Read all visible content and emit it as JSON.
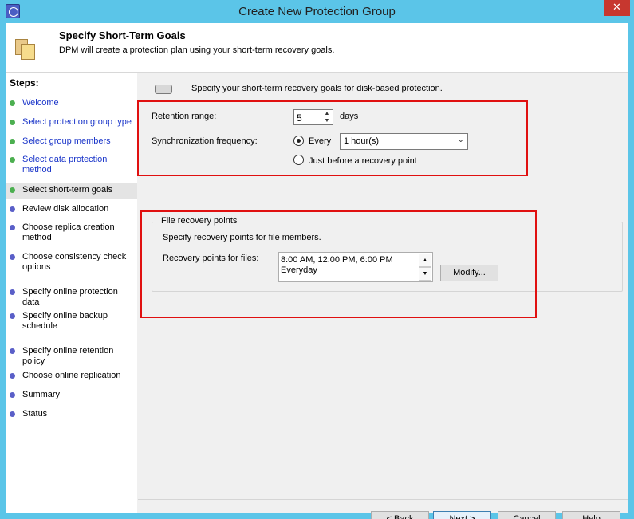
{
  "window": {
    "title": "Create New Protection Group",
    "close_glyph": "✕"
  },
  "header": {
    "title": "Specify Short-Term Goals",
    "description": "DPM will create a protection plan using your short-term recovery goals."
  },
  "steps": {
    "title": "Steps:",
    "items": [
      {
        "label": "Welcome",
        "status": "done"
      },
      {
        "label": "Select protection group type",
        "status": "done"
      },
      {
        "label": "Select group members",
        "status": "done"
      },
      {
        "label": "Select data protection method",
        "status": "done"
      },
      {
        "label": "Select short-term goals",
        "status": "current"
      },
      {
        "label": "Review disk allocation",
        "status": "pending"
      },
      {
        "label": "Choose replica creation method",
        "status": "pending"
      },
      {
        "label": "Choose consistency check options",
        "status": "pending"
      },
      {
        "label": "Specify online protection data",
        "status": "pending"
      },
      {
        "label": "Specify online backup schedule",
        "status": "pending"
      },
      {
        "label": "Specify online retention policy",
        "status": "pending"
      },
      {
        "label": "Choose online replication",
        "status": "pending"
      },
      {
        "label": "Summary",
        "status": "pending"
      },
      {
        "label": "Status",
        "status": "pending"
      }
    ]
  },
  "main": {
    "intro": "Specify your short-term recovery goals for disk-based protection.",
    "retention": {
      "label": "Retention range:",
      "value": "5",
      "unit": "days"
    },
    "sync": {
      "label": "Synchronization frequency:",
      "every_label": "Every",
      "every_selected": true,
      "interval": "1 hour(s)",
      "before_label": "Just before a recovery point"
    },
    "file_recovery": {
      "group_title": "File recovery points",
      "description": "Specify recovery points for file members.",
      "points_label": "Recovery points for files:",
      "schedule_line1": "8:00 AM, 12:00 PM, 6:00 PM",
      "schedule_line2": "Everyday",
      "modify_label": "Modify..."
    }
  },
  "footer": {
    "back_label": "< Back",
    "next_label": "Next >",
    "cancel_label": "Cancel",
    "help_label": "Help"
  },
  "colors": {
    "titlebar": "#5bc5e8",
    "highlight_box": "#e01010",
    "step_done_dot": "#4caf50",
    "step_pending_dot": "#5a5fc8",
    "link_text": "#1a35c9"
  }
}
